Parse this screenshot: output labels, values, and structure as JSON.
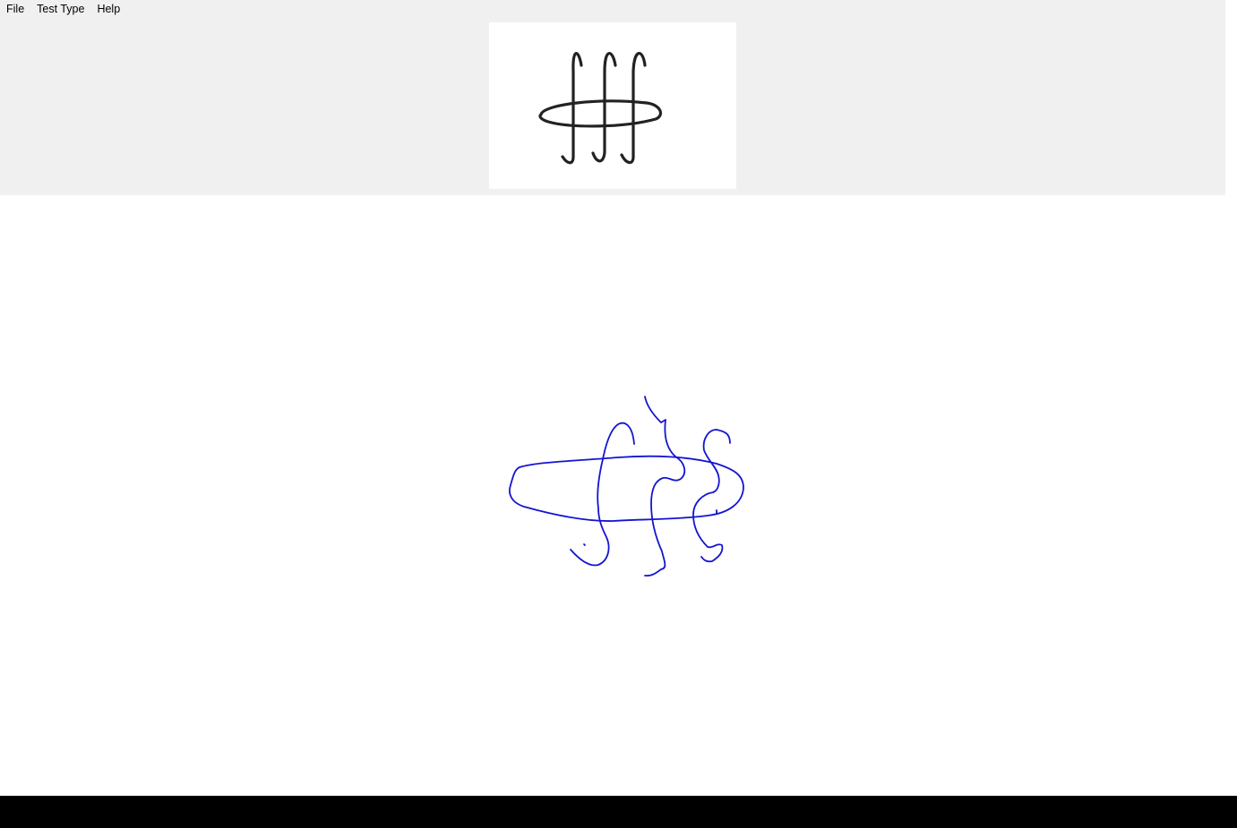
{
  "menu": {
    "file": "File",
    "test_type": "Test Type",
    "help": "Help"
  },
  "colors": {
    "reference_stroke": "#222222",
    "user_stroke": "#1414d2",
    "toolbar_bg": "#f0f0f0"
  },
  "icons": {
    "reference": "reference-symbol-image",
    "drawing": "handwriting-strokes"
  }
}
